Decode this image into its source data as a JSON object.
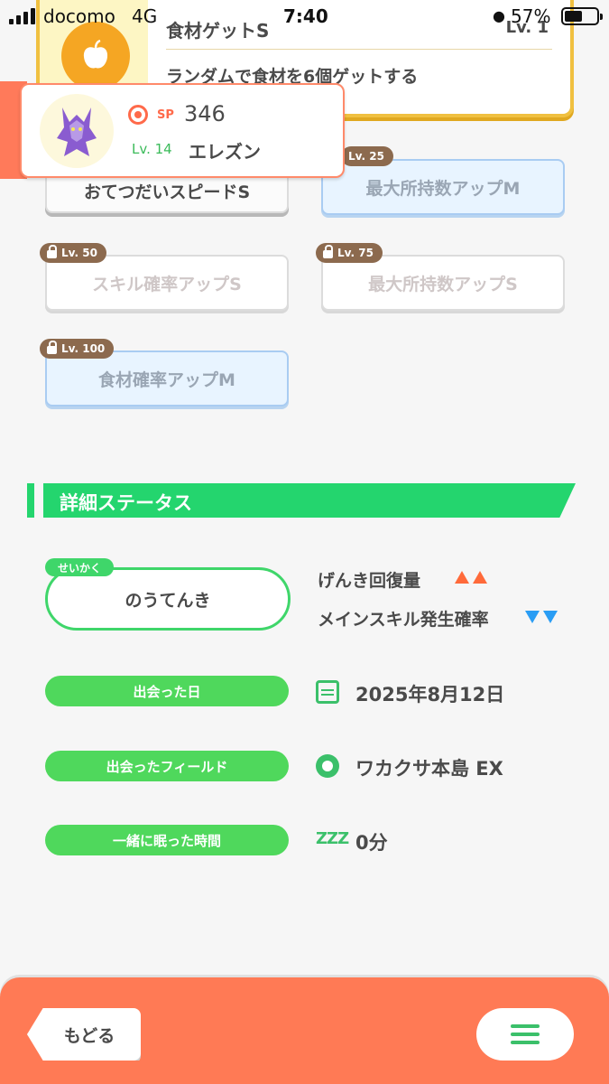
{
  "status_bar": {
    "carrier": "docomo",
    "network": "4G",
    "time": "7:40",
    "battery": "57%",
    "battery_level": 0.57
  },
  "skill_card": {
    "name": "食材ゲットS",
    "level": "Lv. 1",
    "description": "ランダムで食材を6個ゲットする",
    "icon": "apple-icon"
  },
  "pokemon": {
    "sp_label": "SP",
    "sp_value": "346",
    "level_label": "Lv. 14",
    "name": "エレズン"
  },
  "sub_skills": [
    {
      "label": "おてつだいスピードS",
      "tag": "",
      "locked": false
    },
    {
      "label": "最大所持数アップM",
      "tag": "Lv. 25",
      "locked": false
    },
    {
      "label": "スキル確率アップS",
      "tag": "Lv. 50",
      "locked": true
    },
    {
      "label": "最大所持数アップS",
      "tag": "Lv. 75",
      "locked": true
    },
    {
      "label": "食材確率アップM",
      "tag": "Lv. 100",
      "locked": true
    }
  ],
  "details": {
    "section_title": "詳細ステータス",
    "nature_tag": "せいかく",
    "nature": "のうてんき",
    "nature_up": "げんき回復量",
    "nature_down": "メインスキル発生確率",
    "met_date_label": "出会った日",
    "met_date": "2025年8月12日",
    "met_field_label": "出会ったフィールド",
    "met_field": "ワカクサ本島 EX",
    "sleep_label": "一緒に眠った時間",
    "sleep_time": "0分",
    "zzz": "ZZZ"
  },
  "footer": {
    "back_label": "もどる"
  },
  "colors": {
    "accent_green": "#24d56e",
    "pill_green": "#4fd85c",
    "footer_orange": "#ff7a55",
    "up_arrow": "#ff6a3a",
    "down_arrow": "#2a9df4"
  }
}
